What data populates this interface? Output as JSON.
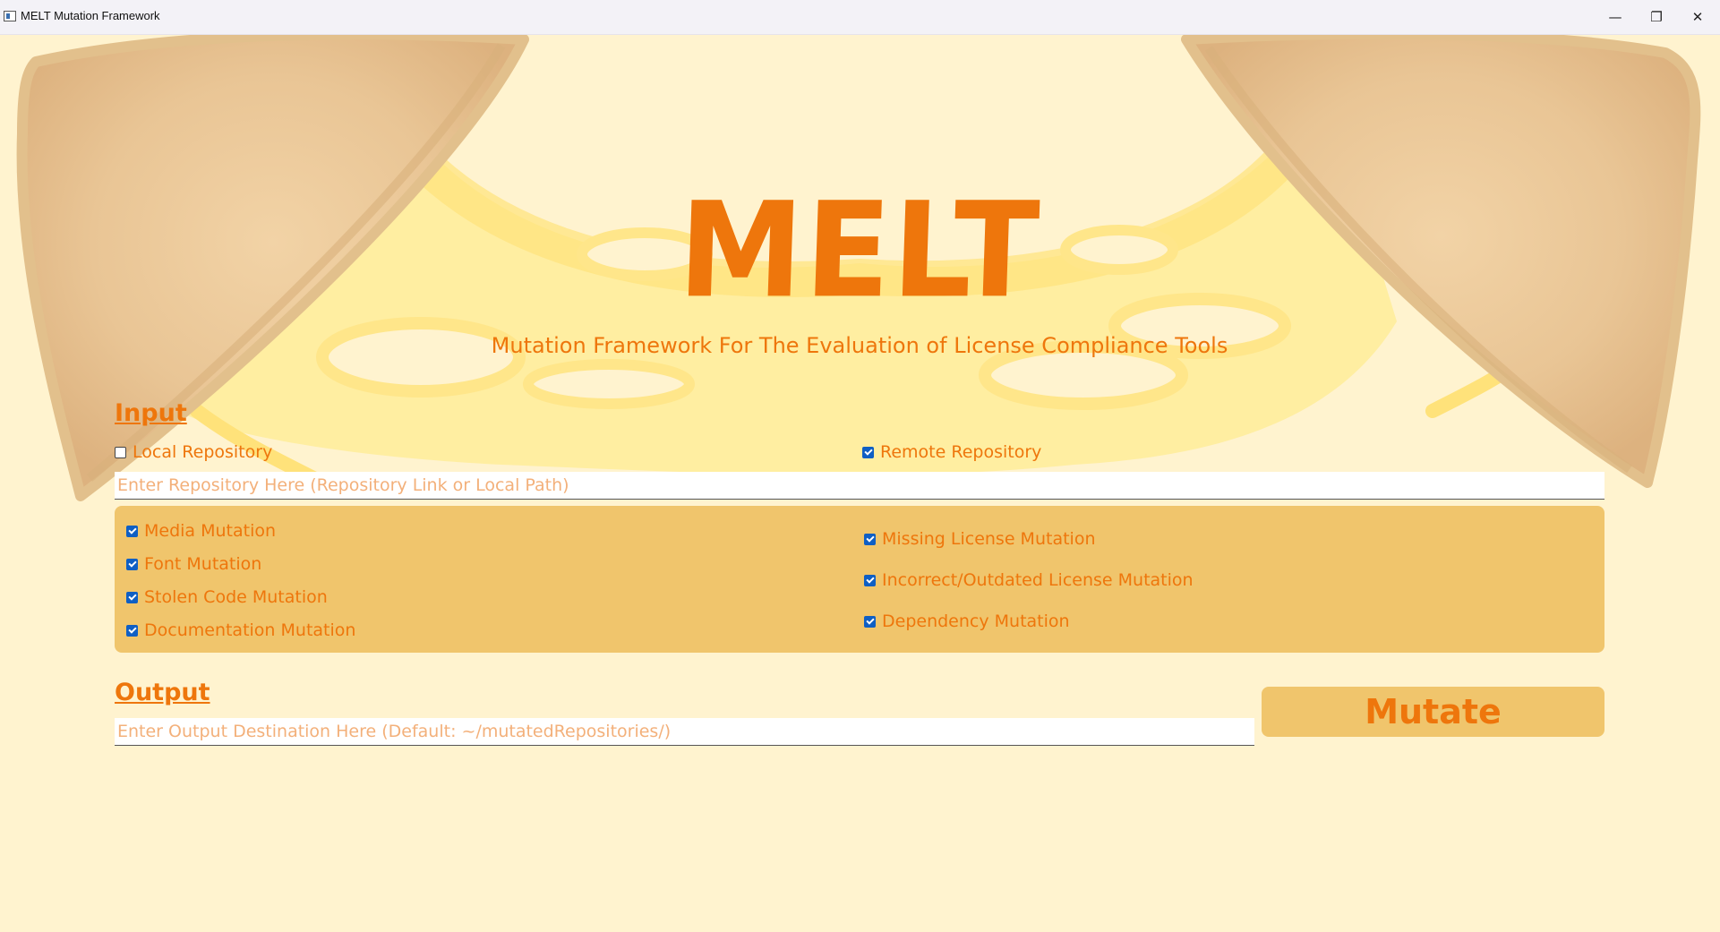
{
  "window": {
    "title": "MELT Mutation Framework",
    "minimize_glyph": "—",
    "maximize_glyph": "❐",
    "close_glyph": "✕"
  },
  "header": {
    "logo": "MELT",
    "subtitle": "Mutation Framework For The Evaluation of License Compliance Tools"
  },
  "colors": {
    "accent": "#EE760C",
    "panel": "#F0C56C",
    "background": "#FFF3CF",
    "checkbox": "#0F5FC4"
  },
  "input": {
    "label": "Input",
    "local_repository": {
      "label": "Local Repository",
      "checked": false
    },
    "remote_repository": {
      "label": "Remote Repository",
      "checked": true
    },
    "repository_field": {
      "value": "",
      "placeholder": "Enter Repository Here (Repository Link or Local Path)"
    }
  },
  "mutations": {
    "left": [
      {
        "label": "Media Mutation",
        "checked": true
      },
      {
        "label": "Font Mutation",
        "checked": true
      },
      {
        "label": "Stolen Code Mutation",
        "checked": true
      },
      {
        "label": "Documentation Mutation",
        "checked": true
      }
    ],
    "right": [
      {
        "label": "Missing License Mutation",
        "checked": true
      },
      {
        "label": "Incorrect/Outdated License Mutation",
        "checked": true
      },
      {
        "label": "Dependency Mutation",
        "checked": true
      }
    ]
  },
  "output": {
    "label": "Output",
    "destination_field": {
      "value": "",
      "placeholder": "Enter Output Destination Here (Default: ~/mutatedRepositories/)"
    },
    "mutate_label": "Mutate"
  }
}
